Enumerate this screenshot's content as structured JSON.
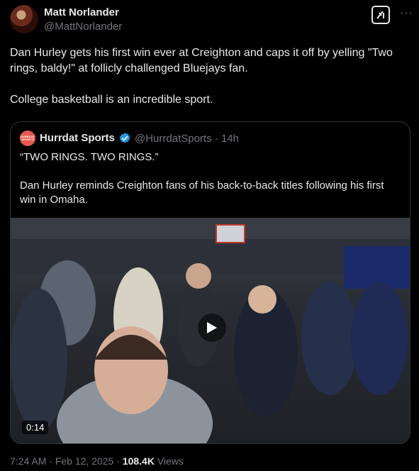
{
  "author": {
    "name": "Matt Norlander",
    "handle": "@MattNorlander"
  },
  "tweet": {
    "paragraphs": [
      "Dan Hurley gets his first win ever at Creighton and caps it off by yelling \"Two rings, baldy!\" at follicly challenged Bluejays fan.",
      "College basketball is an incredible sport."
    ]
  },
  "quoted": {
    "avatar_text": "HURRDAT SPORTS",
    "name": "Hurrdat Sports",
    "handle": "@HurrdatSports",
    "separator": "·",
    "time": "14h",
    "paragraphs": [
      "“TWO RINGS. TWO RINGS.”",
      "Dan Hurley reminds Creighton fans of his back-to-back titles following his first win in Omaha."
    ],
    "video": {
      "duration": "0:14"
    }
  },
  "footer": {
    "time": "7:24 AM",
    "sep1": "·",
    "date": "Feb 12, 2025",
    "sep2": "·",
    "views_count": "108.4K",
    "views_label": "Views"
  },
  "icons": {
    "grok": "grok-icon",
    "more": "more-icon",
    "verified": "verified-icon",
    "play": "play-icon"
  },
  "colors": {
    "background": "#000000",
    "text": "#e7e9ea",
    "secondary": "#71767b",
    "border": "#2f3336",
    "verified_blue": "#1d9bf0",
    "hurrdat_red": "#e65a4f"
  }
}
